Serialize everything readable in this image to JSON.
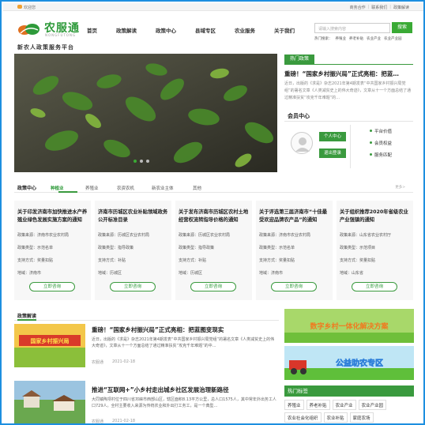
{
  "topbar": {
    "welcome": "欢迎您",
    "links": [
      "商务合作",
      "联系我们",
      "政策解读"
    ]
  },
  "brand": {
    "name": "农服通",
    "name_en": "NONGFUTONG",
    "slogan": "新农人政策服务平台"
  },
  "nav": [
    "首页",
    "政策解读",
    "政策中心",
    "县域专区",
    "农业服务",
    "关于我们"
  ],
  "search": {
    "placeholder": "请输入搜索内容",
    "button": "搜索",
    "hot_label": "热门搜索：",
    "hot": [
      "养殖业",
      "养老补贴",
      "农业产业",
      "农业产业园"
    ]
  },
  "hot": {
    "tag": "热门政策",
    "title": "重磅！“国家乡村振兴局”正式亮相：把蓝…",
    "body": "近日，出版的《求是》杂志2021年第4期发表“中共国家乡村振兴局党组”的署名文章《人类减贫史上的伟大奇迹》，文章从十一个方面总结了通过精准扶贫“攻克千年难题”的…"
  },
  "member": {
    "title": "会员中心",
    "btn_center": "个人中心",
    "btn_login": "退出登录",
    "links": [
      "平台价值",
      "会员权益",
      "服务匹配"
    ]
  },
  "policy": {
    "title": "政策中心",
    "tabs": [
      "种植业",
      "养殖业",
      "农资农机",
      "新农业主体",
      "其他"
    ],
    "more": "更多>",
    "cards": [
      {
        "title": "关于印发济南市加快推进水产养殖业绿色发展实施方案的通知",
        "source": "政策来源：济南市农业农村局",
        "type": "政策类型：示范名单",
        "method": "支持方式：奖量扣贴",
        "region": "地域：济南市",
        "btn": "立即咨询"
      },
      {
        "title": "济南市历城区农业补贴领域政务公开标准目录",
        "source": "政策来源：历城区农业农村局",
        "type": "政策类型：指导政策",
        "method": "支持方式：补贴",
        "region": "地域：历城区",
        "btn": "立即咨询"
      },
      {
        "title": "关于发布济南市历城区农村土地经营权流转指导价格的通知",
        "source": "政策来源：历城区农业农村局",
        "type": "政策类型：指导政策",
        "method": "支持方式：补贴",
        "region": "地域：历城区",
        "btn": "立即咨询"
      },
      {
        "title": "关于评选第三届济南市“十佳最受欢迎品牌农产品”的通知",
        "source": "政策来源：济南市农业农村局",
        "type": "政策类型：示范名单",
        "method": "支持方式：奖量扣贴",
        "region": "地域：济南市",
        "btn": "立即咨询"
      },
      {
        "title": "关于组织推荐2020年省级农业产业强镇的通知",
        "source": "政策来源：山东省农业农村厅",
        "type": "政策类型：示范项目",
        "method": "支持方式：奖量扣贴",
        "region": "地域：山东省",
        "btn": "立即咨询"
      }
    ]
  },
  "news": {
    "title": "政策解读",
    "items": [
      {
        "img_text": "国家乡村振兴局",
        "title": "重磅！“国家乡村振兴局”正式亮相：把蓝图变现实",
        "body": "近日，出版的《求是》杂志2021年第4期发表“中共国家乡村振兴局党组”的署名文章《人类减贫史上的伟大奇迹》，文章从十一个方面总结了通过精准扶贫“攻克千年难题”的中…",
        "source": "农服通",
        "date": "2021-02-18"
      },
      {
        "title": "推进“互联网+”小乡村走出城乡社区发展治理新路径",
        "body": "大同镇陶坝村位于四川省邛崃市西部山区，辖区面积8.13平方公里，总人口1575人，其中常年外出务工人口729人。全村主要收入来源为传统农业和外出打工务工，是一个典型…",
        "source": "农服通",
        "date": "2021-02-18"
      }
    ]
  },
  "banners": [
    {
      "text": "数字乡村一体化解决方案"
    },
    {
      "text": "公益助农专区"
    }
  ],
  "tags": {
    "title": "热门标签",
    "items": [
      "养殖业",
      "养老补贴",
      "农业产业",
      "农业产业园",
      "农业社会化组织",
      "农业补贴",
      "家庭农场"
    ]
  },
  "colors": {
    "accent": "#3a9a3e",
    "frame": "#1d8fe0"
  }
}
